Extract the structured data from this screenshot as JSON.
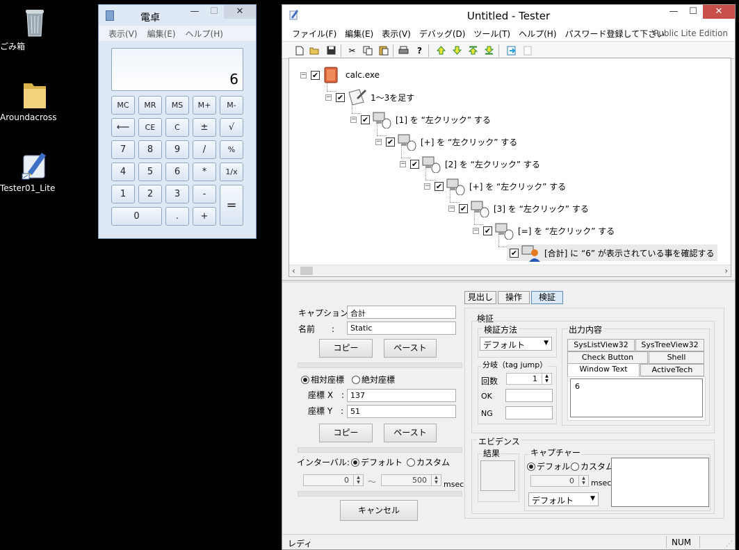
{
  "desktop": {
    "icons": [
      {
        "label": "ごみ箱"
      },
      {
        "label": "Aroundacross"
      },
      {
        "label": "Tester01_Lite"
      }
    ]
  },
  "calculator": {
    "title": "電卓",
    "menu": [
      "表示(V)",
      "編集(E)",
      "ヘルプ(H)"
    ],
    "display_value": "6",
    "buttons": [
      "MC",
      "MR",
      "MS",
      "M+",
      "M-",
      "⟵",
      "CE",
      "C",
      "±",
      "√",
      "7",
      "8",
      "9",
      "/",
      "%",
      "4",
      "5",
      "6",
      "*",
      "1/x",
      "1",
      "2",
      "3",
      "-",
      "=",
      "0",
      ".",
      "+"
    ],
    "controls": {
      "minimize": "—",
      "maximize": "☐",
      "close": "✕"
    }
  },
  "tester": {
    "title": "Untitled - Tester",
    "controls": {
      "minimize": "—",
      "maximize": "☐",
      "close": "✕"
    },
    "menu": [
      "ファイル(F)",
      "編集(E)",
      "表示(V)",
      "デバッグ(D)",
      "ツール(T)",
      "ヘルプ(H)",
      "パスワード登録して下さい"
    ],
    "edition": "Public Lite Edition",
    "tree": [
      {
        "label": "calc.exe"
      },
      {
        "label": "1～3を足す"
      },
      {
        "label": "[1] を “左クリック” する"
      },
      {
        "label": "[+] を “左クリック” する"
      },
      {
        "label": "[2] を “左クリック” する"
      },
      {
        "label": "[+] を “左クリック” する"
      },
      {
        "label": "[3] を “左クリック” する"
      },
      {
        "label": "[=] を “左クリック” する"
      },
      {
        "label": "[合計] に “6” が表示されている事を確認する"
      }
    ],
    "left_panel": {
      "caption_label": "キャプション:",
      "caption_value": "合計",
      "name_label": "名前　　:",
      "name_value": "Static",
      "copy_label": "コピー",
      "paste_label": "ペースト",
      "relative_label": "相対座標",
      "absolute_label": "絶対座標",
      "x_label": "座標 X　:",
      "x_value": "137",
      "y_label": "座標 Y　:",
      "y_value": "51",
      "copy2_label": "コピー",
      "paste2_label": "ペースト",
      "interval_label": "インターバル:",
      "default_label": "デフォルト",
      "custom_label": "カスタム",
      "interval_from": "0",
      "tilde": "～",
      "interval_to": "500",
      "msec": "msec",
      "cancel_label": "キャンセル"
    },
    "right_panel": {
      "tabs": [
        "見出し",
        "操作",
        "検証"
      ],
      "verify_group": "検証",
      "method_group": "検証方法",
      "method_value": "デフォルト",
      "branch_group": "分岐（tag jump）",
      "count_label": "回数",
      "count_value": "1",
      "ok_label": "OK",
      "ng_label": "NG",
      "output_group": "出力内容",
      "output_tabs": [
        "SysListView32",
        "SysTreeView32",
        "Check Button",
        "Shell",
        "Window Text",
        "ActiveTech"
      ],
      "output_value": "6",
      "evidence_group": "エビデンス",
      "result_group": "結果",
      "capture_group": "キャプチャー",
      "cap_default": "デフォルト",
      "cap_custom": "カスタム",
      "cap_spin_value": "0",
      "cap_msec": "msec",
      "cap_combo": "デフォルト"
    },
    "status": {
      "left": "レディ",
      "num": "NUM"
    }
  }
}
